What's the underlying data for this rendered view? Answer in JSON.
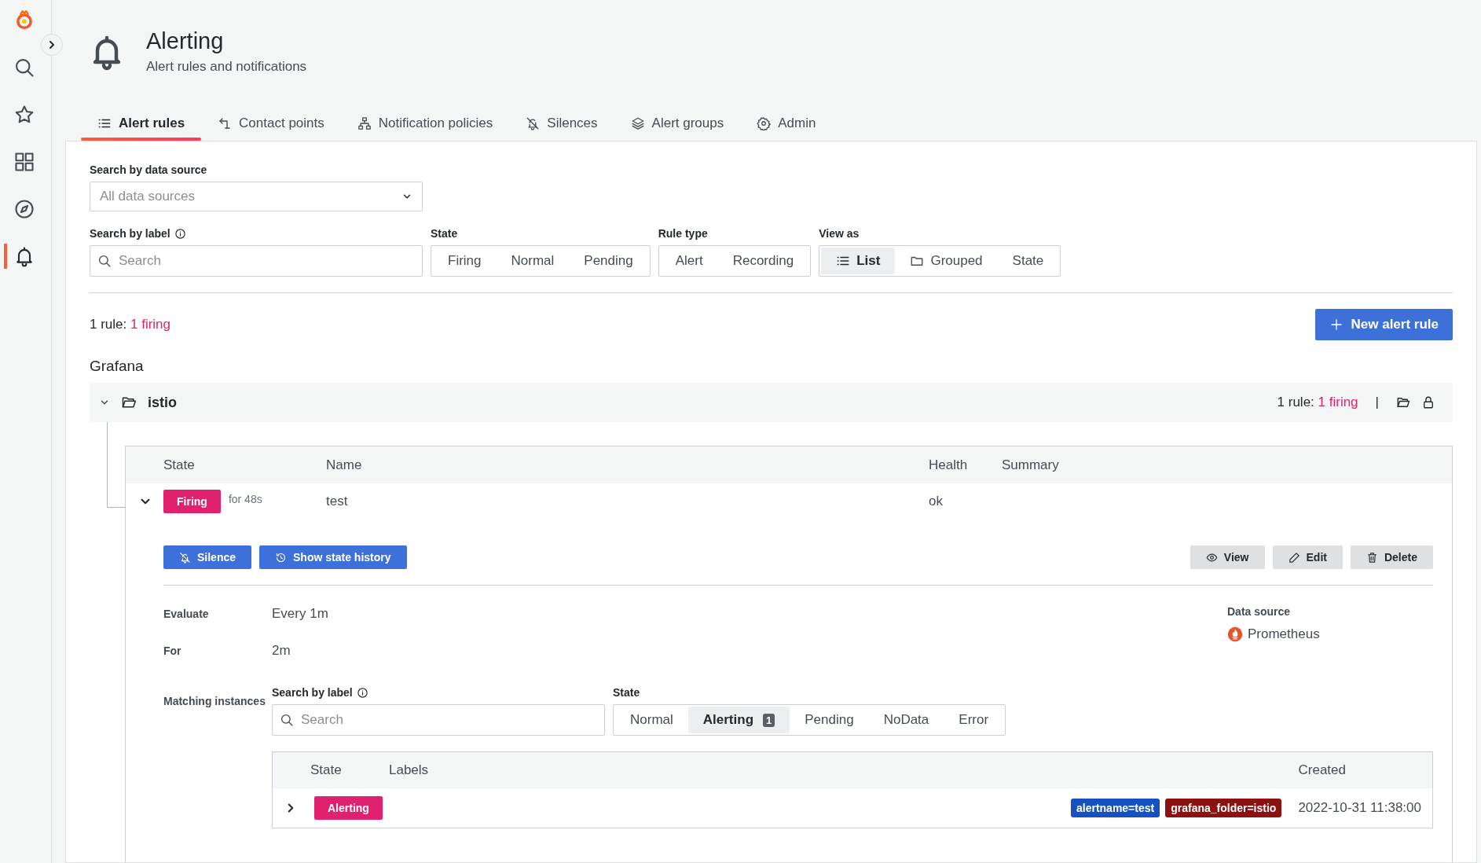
{
  "sidebar": {
    "items": [
      {
        "selected": false
      },
      {
        "selected": false
      },
      {
        "selected": false
      },
      {
        "selected": false
      },
      {
        "selected": false
      },
      {
        "selected": true
      }
    ]
  },
  "header": {
    "title": "Alerting",
    "subtitle": "Alert rules and notifications"
  },
  "tabs": [
    {
      "label": "Alert rules",
      "selected": true
    },
    {
      "label": "Contact points",
      "selected": false
    },
    {
      "label": "Notification policies",
      "selected": false
    },
    {
      "label": "Silences",
      "selected": false
    },
    {
      "label": "Alert groups",
      "selected": false
    },
    {
      "label": "Admin",
      "selected": false
    }
  ],
  "filters": {
    "data_source": {
      "label": "Search by data source",
      "placeholder": "All data sources"
    },
    "label_search": {
      "label": "Search by label",
      "placeholder": "Search"
    },
    "state": {
      "label": "State",
      "options": [
        {
          "label": "Firing",
          "selected": false
        },
        {
          "label": "Normal",
          "selected": false
        },
        {
          "label": "Pending",
          "selected": false
        }
      ]
    },
    "rule_type": {
      "label": "Rule type",
      "options": [
        {
          "label": "Alert",
          "selected": false
        },
        {
          "label": "Recording",
          "selected": false
        }
      ]
    },
    "view_as": {
      "label": "View as",
      "options": [
        {
          "label": "List",
          "selected": true
        },
        {
          "label": "Grouped",
          "selected": false
        },
        {
          "label": "State",
          "selected": false
        }
      ]
    }
  },
  "summary": {
    "prefix": "1 rule:",
    "firing": "1 firing"
  },
  "new_rule_button": "New alert rule",
  "section_title": "Grafana",
  "folder": {
    "name": "istio",
    "expanded": true,
    "prefix": "1 rule:",
    "firing": "1 firing",
    "separator": "|"
  },
  "rules_table": {
    "columns": [
      "State",
      "Name",
      "Health",
      "Summary"
    ],
    "rows": [
      {
        "expanded": true,
        "state": "Firing",
        "duration": "for 48s",
        "name": "test",
        "health": "ok"
      }
    ]
  },
  "rule_details": {
    "actions_left": [
      "Silence",
      "Show state history"
    ],
    "actions_right": [
      "View",
      "Edit",
      "Delete"
    ],
    "fields": [
      {
        "label": "Evaluate",
        "value": "Every 1m"
      },
      {
        "label": "For",
        "value": "2m"
      }
    ],
    "data_source": {
      "label": "Data source",
      "value": "Prometheus"
    },
    "matching": {
      "label": "Matching instances",
      "search": {
        "label": "Search by label",
        "placeholder": "Search"
      },
      "state": {
        "label": "State",
        "options": [
          {
            "label": "Normal",
            "selected": false
          },
          {
            "label": "Alerting",
            "count": "1",
            "selected": true
          },
          {
            "label": "Pending",
            "selected": false
          },
          {
            "label": "NoData",
            "selected": false
          },
          {
            "label": "Error",
            "selected": false
          }
        ]
      },
      "table": {
        "columns": [
          "State",
          "Labels",
          "Created"
        ],
        "rows": [
          {
            "expanded": false,
            "state": "Alerting",
            "labels": [
              {
                "text": "alertname=test",
                "color": "#1651c0"
              },
              {
                "text": "grafana_folder=istio",
                "color": "#8b1210"
              }
            ],
            "created": "2022-10-31 11:38:00"
          }
        ]
      }
    }
  }
}
